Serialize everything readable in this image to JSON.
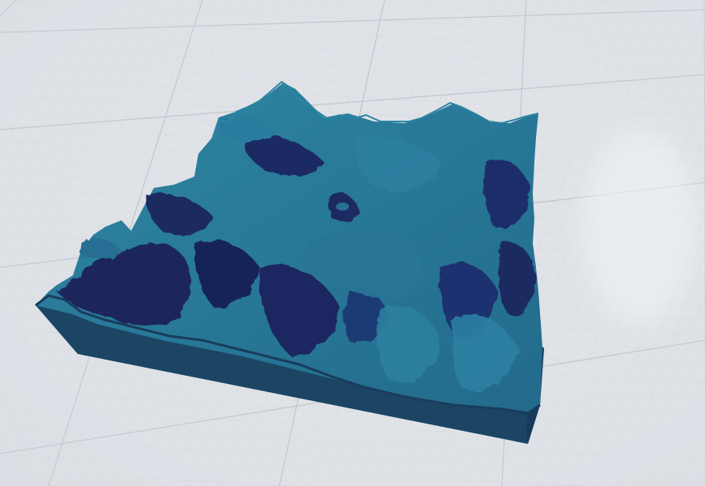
{
  "scene": {
    "colors": {
      "background": "#dfe2e7",
      "grid_fine": "#c9ced6",
      "grid_major": "#b4bac3",
      "terrain_light": "#2f7f9c",
      "terrain_mid": "#24678a",
      "terrain_dark": "#1b275e",
      "terrain_shadow": "#141d4f",
      "base_side": "#1d4d6b",
      "base_front": "#1a4360"
    }
  }
}
